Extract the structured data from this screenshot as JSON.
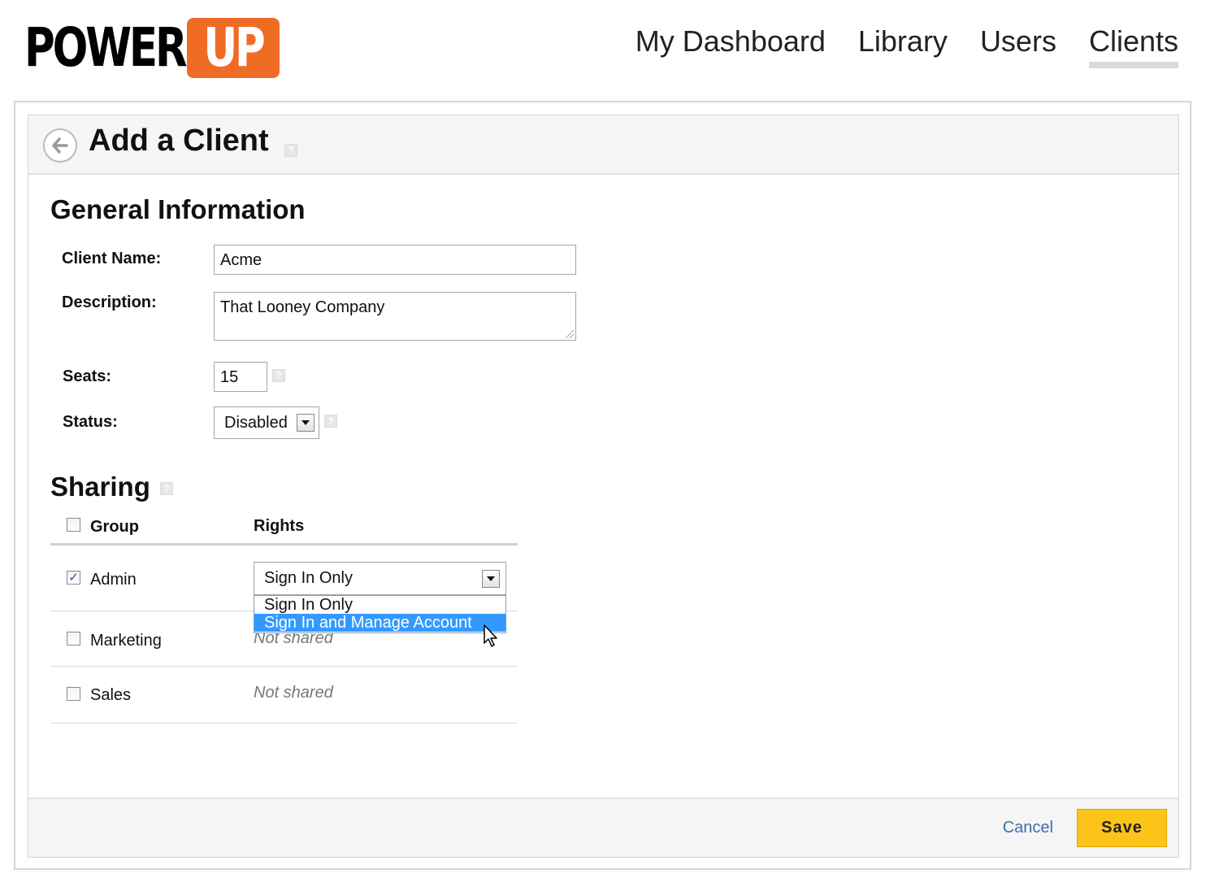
{
  "brand": {
    "logo_left": "POWER",
    "logo_right": "UP",
    "accent": "#f06c25"
  },
  "nav": {
    "items": [
      {
        "label": "My Dashboard",
        "active": false
      },
      {
        "label": "Library",
        "active": false
      },
      {
        "label": "Users",
        "active": false
      },
      {
        "label": "Clients",
        "active": true
      }
    ]
  },
  "page": {
    "title": "Add a Client",
    "back_icon": "back-arrow-icon",
    "help_glyph": "?"
  },
  "general": {
    "heading": "General Information",
    "client_name_label": "Client Name:",
    "client_name_value": "Acme",
    "description_label": "Description:",
    "description_value": "That Looney Company",
    "seats_label": "Seats:",
    "seats_value": "15",
    "status_label": "Status:",
    "status_value": "Disabled"
  },
  "sharing": {
    "heading": "Sharing",
    "col_group": "Group",
    "col_rights": "Rights",
    "rows": [
      {
        "group": "Admin",
        "checked": true,
        "rights": "Sign In Only"
      },
      {
        "group": "Marketing",
        "checked": false,
        "rights": "Not shared"
      },
      {
        "group": "Sales",
        "checked": false,
        "rights": "Not shared"
      }
    ],
    "rights_options": [
      "Sign In Only",
      "Sign In and Manage Account"
    ],
    "highlighted_option": "Sign In and Manage Account"
  },
  "footer": {
    "cancel_label": "Cancel",
    "save_label": "Save",
    "save_color": "#fcc419",
    "link_color": "#3b6fb0"
  }
}
